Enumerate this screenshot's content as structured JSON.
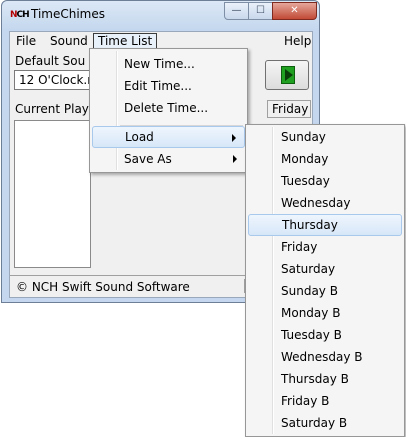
{
  "window": {
    "title": "TimeChimes",
    "controls": {
      "minimize": "—",
      "maximize": "☐",
      "close": "✕"
    }
  },
  "menubar": {
    "file": "File",
    "sound": "Sound",
    "time_list": "Time List",
    "help": "Help"
  },
  "main": {
    "default_sound_label": "Default Sou",
    "default_sound_value": "12 O'Clock.n",
    "current_label": "Current Play",
    "day_label": "Friday"
  },
  "status": {
    "text": "© NCH Swift Sound Software"
  },
  "time_list_menu": {
    "items": [
      {
        "label": "New Time..."
      },
      {
        "label": "Edit Time..."
      },
      {
        "label": "Delete Time..."
      },
      {
        "label": "Load",
        "highlighted": true
      },
      {
        "label": "Save As"
      }
    ]
  },
  "load_submenu": {
    "highlighted": "Thursday",
    "items": [
      "Sunday",
      "Monday",
      "Tuesday",
      "Wednesday",
      "Thursday",
      "Friday",
      "Saturday",
      "Sunday B",
      "Monday B",
      "Tuesday B",
      "Wednesday B",
      "Thursday B",
      "Friday B",
      "Saturday B"
    ]
  },
  "colors": {
    "play_green": "#20a020",
    "close_red": "#c24a36",
    "highlight": "#d7e7f8"
  }
}
